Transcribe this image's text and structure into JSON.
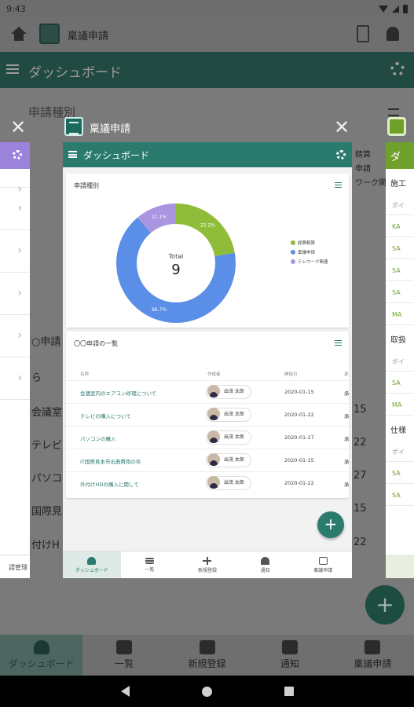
{
  "status_bar": {
    "time": "9:43"
  },
  "background_app": {
    "app_title": "稟議申請",
    "header_title": "ダッシュボード",
    "section_title": "申請種別",
    "fragments": [
      "精算",
      "申請",
      "ワーク関",
      "○申請",
      "ら",
      "会議室内",
      "テレビの",
      "パソコン",
      "国際見",
      "付けH"
    ],
    "right_numbers": [
      "15",
      "22",
      "27",
      "15",
      "22"
    ],
    "nav": [
      {
        "label": "ダッシュボード",
        "icon": "dashboard-icon"
      },
      {
        "label": "一覧",
        "icon": "list-icon"
      },
      {
        "label": "新規登録",
        "icon": "plus-icon"
      },
      {
        "label": "通知",
        "icon": "bell-icon"
      },
      {
        "label": "稟議申請",
        "icon": "app-icon"
      }
    ],
    "fab": "+"
  },
  "left_card": {
    "footer": "請管理"
  },
  "right_card": {
    "header": "ダ",
    "groups": [
      {
        "label": "施工",
        "cells": [
          "ポイ",
          "KA",
          "SA",
          "SA",
          "SA",
          "MA"
        ]
      },
      {
        "label": "取扱",
        "cells": [
          "ポイ",
          "SA",
          "MA"
        ]
      },
      {
        "label": "仕様",
        "cells": [
          "ポイ",
          "SA",
          "SA"
        ]
      }
    ]
  },
  "main_card": {
    "app_title": "稟議申請",
    "header_title": "ダッシュボード",
    "panel1": {
      "title": "申請種別",
      "total_label": "Total",
      "total_value": "9",
      "chart_data": {
        "type": "pie",
        "categories": [
          "経費精算",
          "稟議申請",
          "テレワーク関連"
        ],
        "values": [
          22.2,
          66.7,
          11.1
        ],
        "data_labels": [
          "22.2%",
          "66.7%",
          "11.1%"
        ],
        "colors": [
          "#8fbd3a",
          "#5b8ee6",
          "#a995e0"
        ],
        "legend_position": "right"
      }
    },
    "panel2": {
      "title": "〇〇申請の一覧",
      "columns": [
        "名称",
        "作成者",
        "開始日",
        "承"
      ],
      "rows": [
        {
          "name": "会議室内のエアコン修理について",
          "author": "出茂 太郎",
          "date": "2020-01-15",
          "extra": "承"
        },
        {
          "name": "テレビの購入について",
          "author": "出茂 太郎",
          "date": "2020-01-22",
          "extra": "承"
        },
        {
          "name": "パソコンの購入",
          "author": "出茂 太郎",
          "date": "2020-01-27",
          "extra": "承"
        },
        {
          "name": "IT国際見本市出典費用の件",
          "author": "出茂 太郎",
          "date": "2020-01-15",
          "extra": "承"
        },
        {
          "name": "外付けHDの購入に関して",
          "author": "出茂 太郎",
          "date": "2020-01-22",
          "extra": "承"
        }
      ]
    },
    "fab": "+",
    "nav": [
      {
        "label": "ダッシュボード",
        "icon": "dashboard-icon"
      },
      {
        "label": "一覧",
        "icon": "list-icon"
      },
      {
        "label": "新規登録",
        "icon": "plus-icon"
      },
      {
        "label": "通知",
        "icon": "bell-icon"
      },
      {
        "label": "稟議申請",
        "icon": "app-icon"
      }
    ]
  }
}
